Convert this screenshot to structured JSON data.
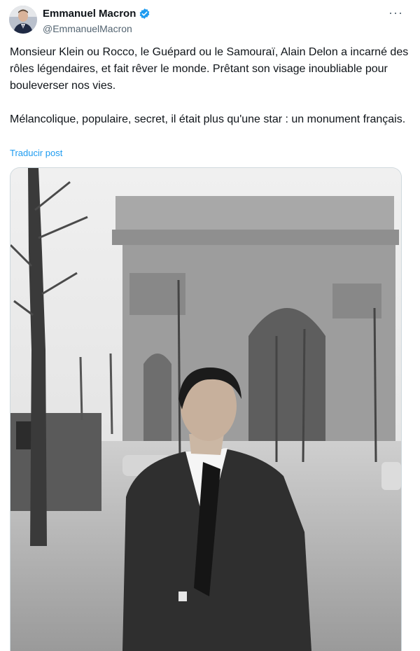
{
  "author": {
    "name": "Emmanuel Macron",
    "handle": "@EmmanuelMacron",
    "verified_icon": "verified-badge-icon",
    "avatar_icon": "avatar"
  },
  "menu": {
    "more_label": "···"
  },
  "tweet": {
    "text": "Monsieur Klein ou Rocco, le Guépard ou le Samouraï, Alain Delon a incarné des rôles légendaires, et fait rêver le monde. Prêtant son visage inoubliable pour bouleverser nos vies.\n\nMélancolique, populaire, secret, il était plus qu'une star : un monument français.",
    "translate_label": "Traducir post"
  },
  "colors": {
    "text": "#0f1419",
    "secondary": "#536471",
    "link": "#1d9bf0",
    "verified": "#1d9bf0"
  }
}
